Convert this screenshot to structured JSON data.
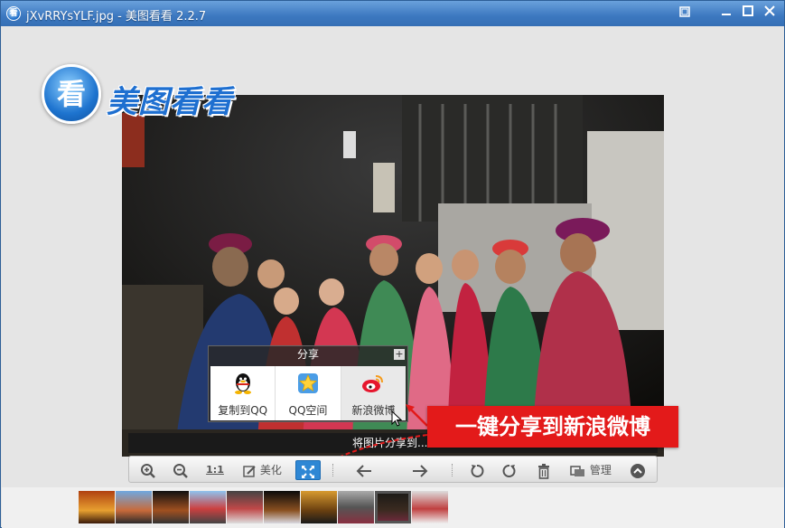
{
  "window": {
    "title": "jXvRRYsYLF.jpg - 美图看看 2.2.7"
  },
  "logo": {
    "glyph": "看",
    "text": "美图看看"
  },
  "share": {
    "header": "分享",
    "plus": "+",
    "items": [
      {
        "label": "复制到QQ",
        "icon": "qq-penguin-icon"
      },
      {
        "label": "QQ空间",
        "icon": "qzone-star-icon"
      },
      {
        "label": "新浪微博",
        "icon": "sina-weibo-icon"
      }
    ]
  },
  "callout": {
    "text": "一键分享到新浪微博"
  },
  "caption": {
    "text": "将图片分享到..."
  },
  "toolbar": {
    "one_to_one": "1:1",
    "beautify": "美化",
    "manage": "管理"
  },
  "colors": {
    "accent": "#2f87d4",
    "callout": "#e31a1a",
    "titlebar": "#3c78c0"
  },
  "thumbnails": {
    "count": 10,
    "selected_index": 8
  }
}
